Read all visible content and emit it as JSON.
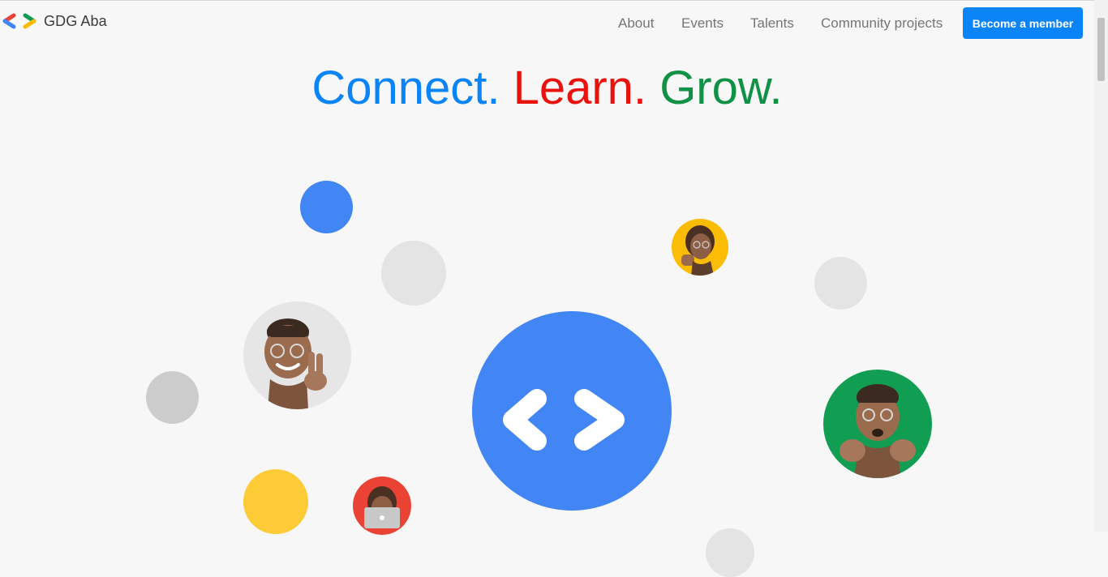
{
  "brand": {
    "name": "GDG Aba"
  },
  "nav": {
    "items": [
      {
        "label": "About"
      },
      {
        "label": "Events"
      },
      {
        "label": "Talents"
      },
      {
        "label": "Community projects"
      }
    ],
    "cta_label": "Become a member"
  },
  "hero": {
    "words": [
      {
        "text": "Connect.",
        "color": "#0a84f7"
      },
      {
        "text": "Learn.",
        "color": "#e8130f"
      },
      {
        "text": "Grow.",
        "color": "#0f9146"
      }
    ]
  },
  "icons": {
    "logo": "gdg-chevrons-icon",
    "center": "code-brackets-icon",
    "avatars": [
      "memoji-peace-sign-avatar",
      "memoji-fist-bump-avatar",
      "memoji-laptop-avatar",
      "memoji-waving-hands-avatar"
    ]
  },
  "colors": {
    "google_blue": "#4285f4",
    "google_red": "#ea4335",
    "google_yellow": "#fbbc05",
    "google_green": "#0f9d58",
    "neutral_light": "#e4e4e4",
    "neutral_mid": "#cccccc"
  }
}
